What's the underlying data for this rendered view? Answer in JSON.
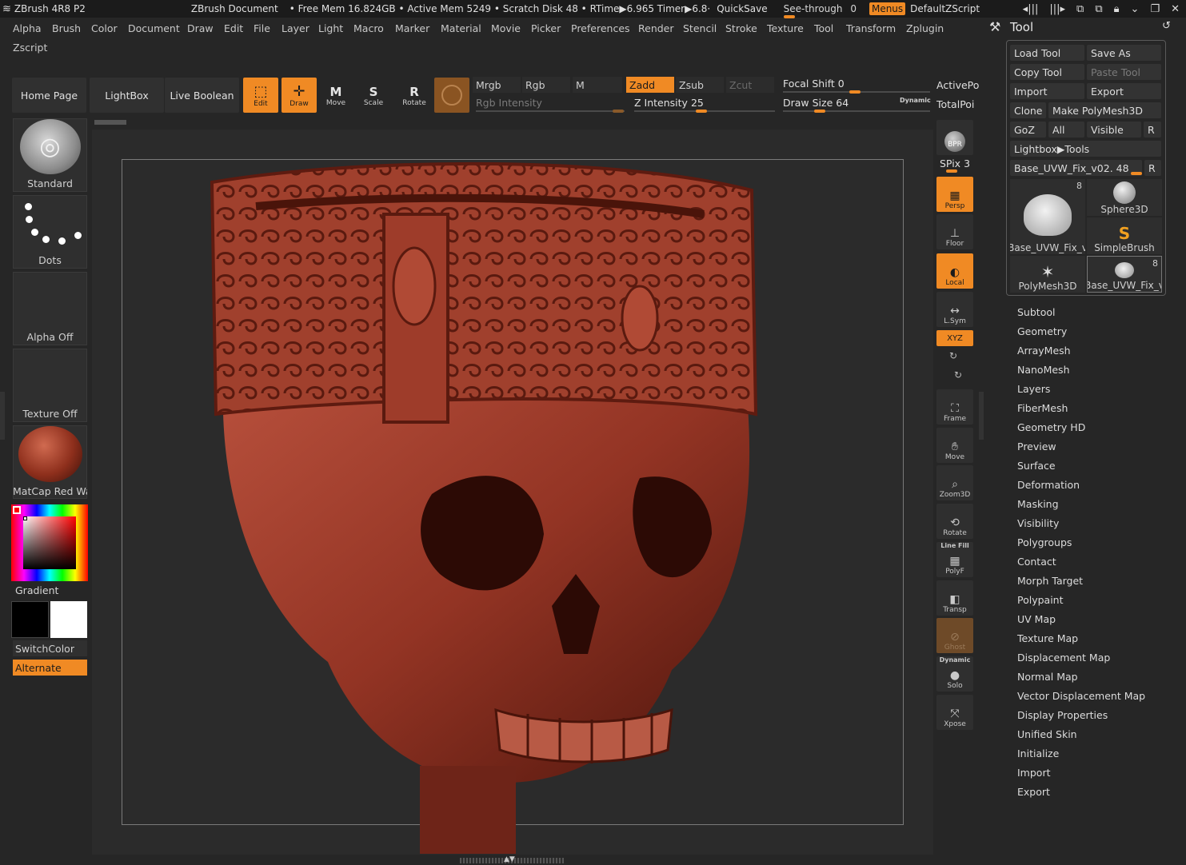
{
  "titlebar": {
    "app": "ZBrush 4R8 P2",
    "document": "ZBrush Document",
    "stats": "• Free Mem 16.824GB • Active Mem 5249 • Scratch Disk 48 • RTime▶6.965 Timer▶6.8·",
    "quicksave": "QuickSave",
    "seethrough": "See-through",
    "seethrough_value": "0",
    "menus": "Menus",
    "script": "DefaultZScript"
  },
  "menubar": {
    "items": [
      "Alpha",
      "Brush",
      "Color",
      "Document",
      "Draw",
      "Edit",
      "File",
      "Layer",
      "Light",
      "Macro",
      "Marker",
      "Material",
      "Movie",
      "Picker",
      "Preferences",
      "Render",
      "Stencil",
      "Stroke",
      "Texture",
      "Tool",
      "Transform",
      "Zplugin"
    ],
    "row2": [
      "Zscript"
    ]
  },
  "toolbar": {
    "home": "Home Page",
    "lightbox": "LightBox",
    "live_boolean": "Live Boolean",
    "edit": "Edit",
    "draw": "Draw",
    "move": "Move",
    "scale": "Scale",
    "rotate": "Rotate",
    "mrgb": "Mrgb",
    "rgb": "Rgb",
    "m": "M",
    "rgb_intensity": "Rgb Intensity",
    "zadd": "Zadd",
    "zsub": "Zsub",
    "zcut": "Zcut",
    "z_intensity_label": "Z Intensity",
    "z_intensity_value": "25",
    "focal_label": "Focal Shift",
    "focal_value": "0",
    "drawsize_label": "Draw Size",
    "drawsize_value": "64",
    "dynamic": "Dynamic",
    "activepoints": "ActivePo",
    "totalpoints": "TotalPoi"
  },
  "left_shelf": {
    "brush": "Standard",
    "stroke": "Dots",
    "alpha": "Alpha Off",
    "texture": "Texture Off",
    "material": "MatCap Red Wax",
    "gradient": "Gradient",
    "switchcolor": "SwitchColor",
    "alternate": "Alternate",
    "colors": {
      "primary": "#000000",
      "secondary": "#ffffff",
      "accent": "#f08a24"
    }
  },
  "right_shelf": {
    "bpr": "BPR",
    "spix_label": "SPix",
    "spix_value": "3",
    "persp": "Persp",
    "floor": "Floor",
    "local": "Local",
    "lsym": "L.Sym",
    "xyz": "XYZ",
    "frame": "Frame",
    "move": "Move",
    "zoom3d": "Zoom3D",
    "rotate": "Rotate",
    "linefill": "Line Fill",
    "polyf": "PolyF",
    "transp": "Transp",
    "ghost": "Ghost",
    "dynamic": "Dynamic",
    "solo": "Solo",
    "xpose": "Xpose"
  },
  "tool_palette": {
    "title": "Tool",
    "load_tool": "Load Tool",
    "save_as": "Save As",
    "copy_tool": "Copy Tool",
    "paste_tool": "Paste Tool",
    "import": "Import",
    "export": "Export",
    "clone": "Clone",
    "make_polymesh": "Make PolyMesh3D",
    "goz": "GoZ",
    "all": "All",
    "visible": "Visible",
    "r": "R",
    "lightbox_tools": "Lightbox▶Tools",
    "current_tool": "Base_UVW_Fix_v02. 48",
    "thumbs": [
      {
        "name": "Base_UVW_Fix_v",
        "count": "8"
      },
      {
        "name": "Sphere3D",
        "count": ""
      },
      {
        "name": "SimpleBrush",
        "count": ""
      },
      {
        "name": "PolyMesh3D",
        "count": ""
      },
      {
        "name": "Base_UVW_Fix_v",
        "count": "8"
      }
    ],
    "subpalettes": [
      "Subtool",
      "Geometry",
      "ArrayMesh",
      "NanoMesh",
      "Layers",
      "FiberMesh",
      "Geometry HD",
      "Preview",
      "Surface",
      "Deformation",
      "Masking",
      "Visibility",
      "Polygroups",
      "Contact",
      "Morph Target",
      "Polypaint",
      "UV Map",
      "Texture Map",
      "Displacement Map",
      "Normal Map",
      "Vector Displacement Map",
      "Display Properties",
      "Unified Skin",
      "Initialize",
      "Import",
      "Export"
    ]
  }
}
